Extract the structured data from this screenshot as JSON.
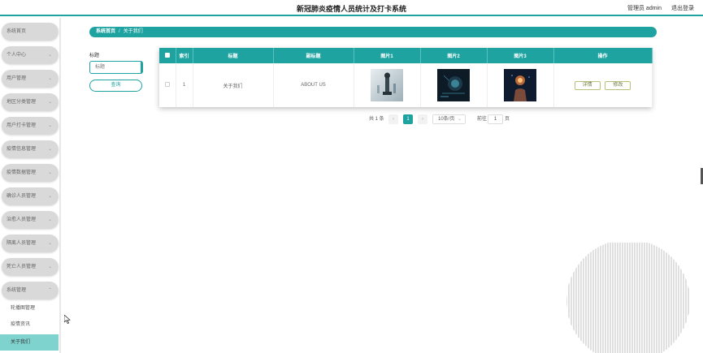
{
  "header": {
    "title": "新冠肺炎疫情人员统计及打卡系统",
    "user_label": "管理员 admin",
    "logout_label": "退出登录"
  },
  "sidebar": {
    "items": [
      {
        "label": "系统首页",
        "has_chevron": false
      },
      {
        "label": "个人中心",
        "has_chevron": true
      },
      {
        "label": "用户管理",
        "has_chevron": true
      },
      {
        "label": "地区分类管理",
        "has_chevron": true
      },
      {
        "label": "用户打卡管理",
        "has_chevron": true
      },
      {
        "label": "疫情信息管理",
        "has_chevron": true
      },
      {
        "label": "疫情数据管理",
        "has_chevron": true
      },
      {
        "label": "确诊人员管理",
        "has_chevron": true
      },
      {
        "label": "治愈人员管理",
        "has_chevron": true
      },
      {
        "label": "隔离人员管理",
        "has_chevron": true
      },
      {
        "label": "死亡人员管理",
        "has_chevron": true
      },
      {
        "label": "系统管理",
        "has_chevron": true
      }
    ],
    "sub_items": [
      {
        "label": "轮播图管理",
        "active": false
      },
      {
        "label": "疫情资讯",
        "active": false
      },
      {
        "label": "关于我们",
        "active": true
      }
    ]
  },
  "breadcrumb": {
    "home": "系统首页",
    "separator": "/",
    "current": "关于我们"
  },
  "search": {
    "label": "标题",
    "placeholder": "标题",
    "button_label": "查询"
  },
  "table": {
    "columns": [
      "索引",
      "标题",
      "副标题",
      "图片1",
      "图片2",
      "图片3",
      "操作"
    ],
    "rows": [
      {
        "index": "1",
        "title": "关于我们",
        "subtitle": "ABOUT US",
        "images": [
          "chess-photo-icon",
          "dark-tech-photo-icon",
          "hand-glow-photo-icon"
        ],
        "actions": [
          "详情",
          "修改"
        ]
      }
    ]
  },
  "pagination": {
    "total_label": "共 1 条",
    "prev": "‹",
    "current_page": "1",
    "next": "›",
    "page_size": "10条/页",
    "goto_label": "前往",
    "goto_value": "1",
    "page_suffix": "页"
  },
  "colors": {
    "accent": "#1fa3a1",
    "sidebar_item": "#d9d9d9",
    "active_sub": "#7fd3cf"
  }
}
